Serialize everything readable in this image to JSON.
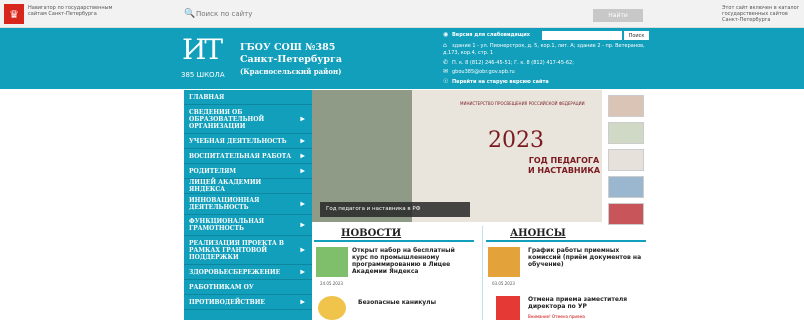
{
  "topbar": {
    "portal_text": "Навигатор по государственным сайтам Санкт-Петербурга",
    "search_placeholder": "Поиск по сайту",
    "search_button": "Найти",
    "right_note": "Этот сайт включен в каталог государственных сайтов Санкт-Петербурга"
  },
  "header": {
    "logo_letters": "ИТ",
    "logo_caption": "385 ШКОЛА",
    "school_line1": "ГБОУ СОШ №385",
    "school_line2": "Санкт-Петербурга",
    "district": "(Красносельский район)",
    "visually_impaired": "Версия для слабовидящих",
    "vis_button": "Поиск",
    "address": "здание 1 - ул. Пионерстрок, д. 5, кор.1, лит. А; здание 2 - пр. Ветеранов, д.173, кор.4, стр. 1",
    "phones": "П. к. 8 (812) 246-45-51; Г. к. 8 (812) 417-45-62;",
    "email": "gbou385@obr.gov.spb.ru",
    "old_version": "Перейти на старую версию сайта"
  },
  "nav": [
    {
      "label": "ГЛАВНАЯ",
      "arrow": false,
      "h": 15
    },
    {
      "label": "СВЕДЕНИЯ ОБ ОБРАЗОВАТЕЛЬНОЙ ОРГАНИЗАЦИИ",
      "arrow": true,
      "h": 29
    },
    {
      "label": "УЧЕБНАЯ ДЕЯТЕЛЬНОСТЬ",
      "arrow": true,
      "h": 15
    },
    {
      "label": "ВОСПИТАТЕЛЬНАЯ РАБОТА",
      "arrow": true,
      "h": 15
    },
    {
      "label": "РОДИТЕЛЯМ",
      "arrow": true,
      "h": 15
    },
    {
      "label": "ЛИЦЕЙ АКАДЕМИИ ЯНДЕКСА",
      "arrow": false,
      "h": 15
    },
    {
      "label": "ИННОВАЦИОННАЯ ДЕЯТЕЛЬНОСТЬ",
      "arrow": true,
      "h": 21
    },
    {
      "label": "ФУНКЦИОНАЛЬНАЯ ГРАМОТНОСТЬ",
      "arrow": true,
      "h": 21
    },
    {
      "label": "РЕАЛИЗАЦИЯ ПРОЕКТА В РАМКАХ ГРАНТОВОЙ ПОДДЕРЖКИ",
      "arrow": true,
      "h": 29
    },
    {
      "label": "ЗДОРОВЬЕСБЕРЕЖЕНИЕ",
      "arrow": true,
      "h": 15
    },
    {
      "label": "РАБОТНИКАМ ОУ",
      "arrow": false,
      "h": 15
    },
    {
      "label": "ПРОТИВОДЕЙСТВИЕ",
      "arrow": true,
      "h": 15
    }
  ],
  "slider": {
    "ministry": "МИНИСТЕРСТВО ПРОСВЕЩЕНИЯ РОССИЙСКОЙ ФЕДЕРАЦИИ",
    "year": "2023",
    "subtitle": "ГОД ПЕДАГОГА И НАСТАВНИКА",
    "caption": "Год педагога и наставника в РФ"
  },
  "news": {
    "title": "НОВОСТИ",
    "items": [
      {
        "title": "Открыт набор на бесплатный курс по промышленному программированию в Лицее Академии Яндекса",
        "date": "24.05.2023"
      },
      {
        "title": "Безопасные каникулы",
        "date": ""
      }
    ]
  },
  "announcements": {
    "title": "АНОНСЫ",
    "items": [
      {
        "title": "График работы приемных комиссий (приём документов на обучение)",
        "date": "03.05.2023"
      },
      {
        "title": "Отмена приема заместителя директора по УР",
        "badge": "Внимание! Отмена приема"
      }
    ]
  },
  "colors": {
    "brand": "#129fbb",
    "accent_red": "#d9261c"
  }
}
